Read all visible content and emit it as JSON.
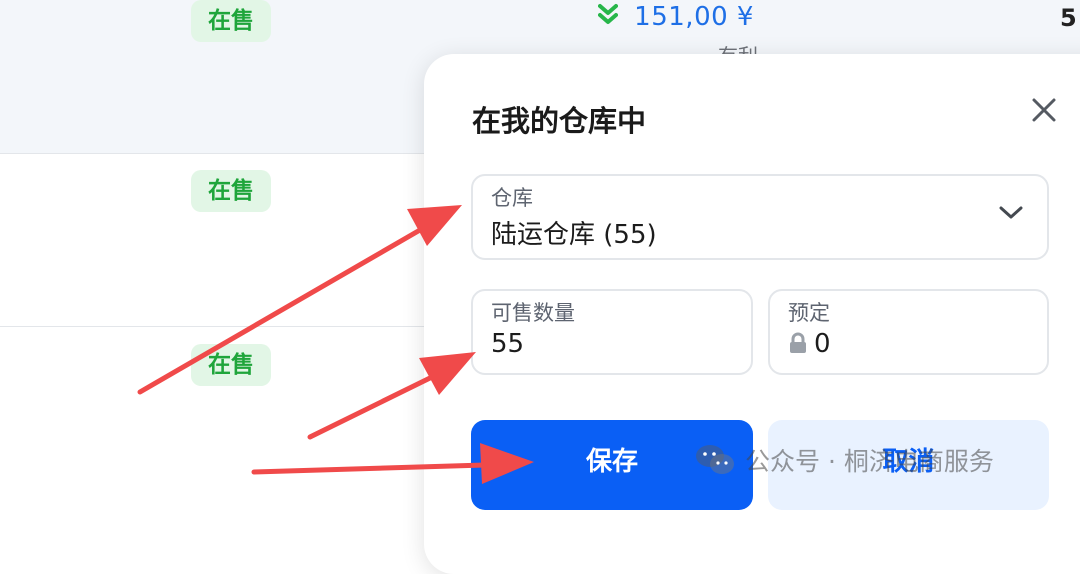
{
  "table": {
    "rows": [
      {
        "status": "在售",
        "price": "151,00 ¥",
        "profit_label": "有利",
        "edge_value": "5"
      },
      {
        "status": "在售"
      },
      {
        "status": "在售"
      }
    ]
  },
  "modal": {
    "title": "在我的仓库中",
    "warehouse": {
      "label": "仓库",
      "value": "陆运仓库 (55)"
    },
    "available_qty": {
      "label": "可售数量",
      "value": "55"
    },
    "reserved": {
      "label": "预定",
      "value": "0"
    },
    "save_label": "保存",
    "cancel_label": "取消"
  },
  "watermark": {
    "text": "公众号 · 桐济电商服务"
  },
  "colors": {
    "accent": "#0a5ff5",
    "status_green": "#1fa53b",
    "arrow_red": "#f04a4a"
  },
  "icons": [
    "chevrons-down-icon",
    "close-icon",
    "chevron-down-icon",
    "lock-icon",
    "wechat-icon"
  ]
}
